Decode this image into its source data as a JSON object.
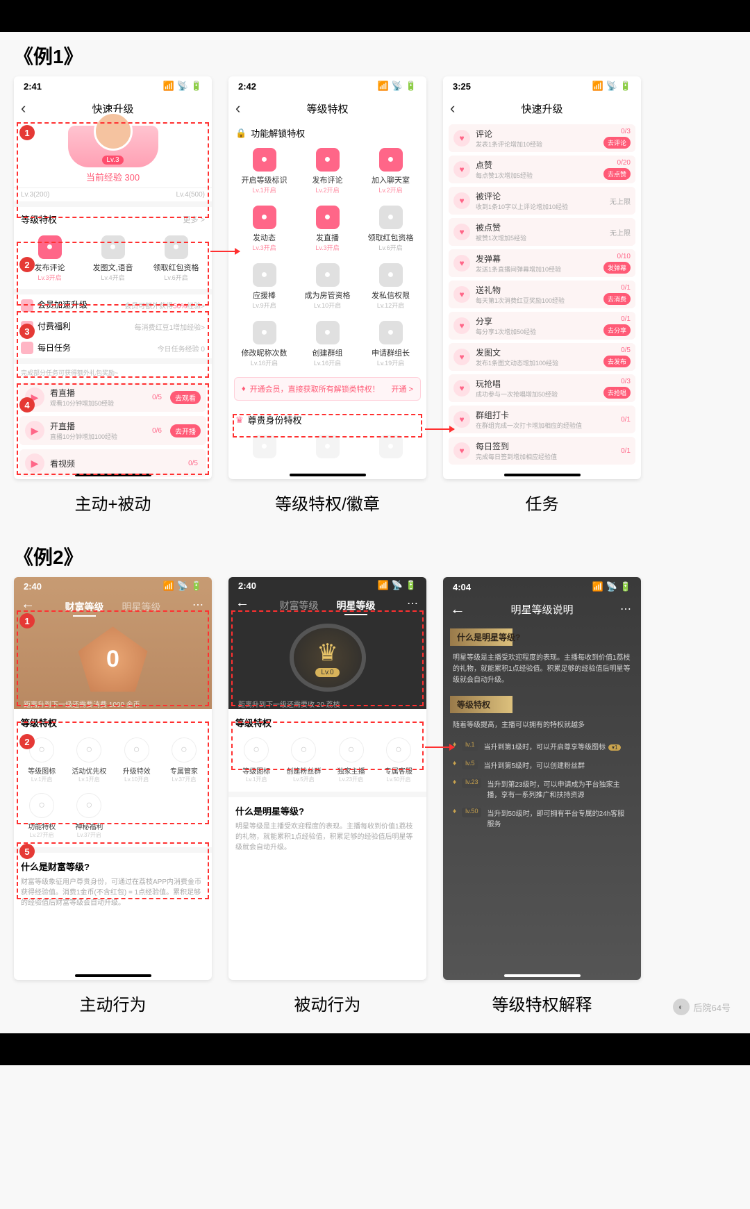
{
  "example1": {
    "label": "《例1》",
    "captions": [
      "主动+被动",
      "等级特权/徽章",
      "任务"
    ],
    "screenA": {
      "time": "2:41",
      "title": "快速升级",
      "hero": {
        "lv_tag": "Lv.3",
        "cur_exp": "当前经验 300",
        "scale_lo": "Lv.3(200)",
        "scale_hi": "Lv.4(500)"
      },
      "priv_header": "等级特权",
      "priv_more": "更多 >",
      "privs": [
        {
          "t": "发布评论",
          "s": "Lv.3开启"
        },
        {
          "t": "发图文,语音",
          "s": "Lv.4开启"
        },
        {
          "t": "领取红包资格",
          "s": "Lv.6开启"
        }
      ],
      "member_hd": "会员加速升级",
      "member_r": "会员可额外获得50%经验>",
      "pay_hd": "付费福利",
      "pay_r": "每消费红豆1增加经验>",
      "daily_hd": "每日任务",
      "daily_r": "今日任务经验 0",
      "bonus_tip": "完成部分任务可获得额外礼包奖励~",
      "tasks": [
        {
          "t": "看直播",
          "s": "观看10分钟增加50经验",
          "cnt": "0/5",
          "btn": "去观看"
        },
        {
          "t": "开直播",
          "s": "直播10分钟增加100经验",
          "cnt": "0/6",
          "btn": "去开播"
        },
        {
          "t": "看视频",
          "s": "",
          "cnt": "0/5",
          "btn": ""
        }
      ]
    },
    "screenB": {
      "time": "2:42",
      "title": "等级特权",
      "sec1": "功能解锁特权",
      "items": [
        {
          "t": "开启等级标识",
          "s": "Lv.1开启",
          "c": "pink"
        },
        {
          "t": "发布评论",
          "s": "Lv.2开启",
          "c": "pink"
        },
        {
          "t": "加入聊天室",
          "s": "Lv.2开启",
          "c": "pink"
        },
        {
          "t": "发动态",
          "s": "Lv.3开启",
          "c": "pink"
        },
        {
          "t": "发直播",
          "s": "Lv.3开启",
          "c": "pink"
        },
        {
          "t": "领取红包资格",
          "s": "Lv.6开启",
          "c": "gray"
        },
        {
          "t": "应援棒",
          "s": "Lv.9开启",
          "c": "gray"
        },
        {
          "t": "成为房管资格",
          "s": "Lv.10开启",
          "c": "gray"
        },
        {
          "t": "发私信权限",
          "s": "Lv.12开启",
          "c": "gray"
        },
        {
          "t": "修改昵称次数",
          "s": "Lv.16开启",
          "c": "gray"
        },
        {
          "t": "创建群组",
          "s": "Lv.16开启",
          "c": "gray"
        },
        {
          "t": "申请群组长",
          "s": "Lv.19开启",
          "c": "gray"
        }
      ],
      "vip_text": "开通会员，直接获取所有解锁类特权！",
      "vip_go": "开通 >",
      "sec2": "尊贵身份特权"
    },
    "screenC": {
      "time": "3:25",
      "title": "快速升级",
      "tasks": [
        {
          "t": "评论",
          "s": "发表1条评论增加10经验",
          "cnt": "0/3",
          "btn": "去评论"
        },
        {
          "t": "点赞",
          "s": "每点赞1次增加5经验",
          "cnt": "0/20",
          "btn": "去点赞"
        },
        {
          "t": "被评论",
          "s": "收到1条10字以上评论增加10经验",
          "cnt": "无上限",
          "btn": ""
        },
        {
          "t": "被点赞",
          "s": "被赞1次增加5经验",
          "cnt": "无上限",
          "btn": ""
        },
        {
          "t": "发弹幕",
          "s": "发送1条直播间弹幕增加10经验",
          "cnt": "0/10",
          "btn": "发弹幕"
        },
        {
          "t": "送礼物",
          "s": "每天第1次消费红豆奖励100经验",
          "cnt": "0/1",
          "btn": "去消费"
        },
        {
          "t": "分享",
          "s": "每分享1次增加50经验",
          "cnt": "0/1",
          "btn": "去分享"
        },
        {
          "t": "发图文",
          "s": "发布1条图文动态增加100经验",
          "cnt": "0/5",
          "btn": "去发布"
        },
        {
          "t": "玩抢唱",
          "s": "成功参与一次抢唱增加50经验",
          "cnt": "0/3",
          "btn": "去抢唱"
        },
        {
          "t": "群组打卡",
          "s": "在群组完成一次打卡增加相应的经验值",
          "cnt": "0/1",
          "btn": ""
        },
        {
          "t": "每日签到",
          "s": "完成每日签到增加相应经验值",
          "cnt": "0/1",
          "btn": ""
        }
      ]
    }
  },
  "example2": {
    "label": "《例2》",
    "captions": [
      "主动行为",
      "被动行为",
      "等级特权解释"
    ],
    "screenA": {
      "time": "2:40",
      "tab_l": "财富等级",
      "tab_r": "明星等级",
      "medal_num": "0",
      "progress_text": "距离升到下一级还需要消费 1000 金币",
      "sec_hd": "等级特权",
      "items": [
        {
          "t": "等级图标",
          "s": "Lv.1开启"
        },
        {
          "t": "活动优先权",
          "s": "Lv.1开启"
        },
        {
          "t": "升级特效",
          "s": "Lv.10开启"
        },
        {
          "t": "专属管家",
          "s": "Lv.37开启"
        },
        {
          "t": "功能特权",
          "s": "Lv.27开启"
        },
        {
          "t": "神秘福利",
          "s": "Lv.37开启"
        }
      ],
      "what_t": "什么是财富等级?",
      "what_p": "财富等级象征用户尊贵身份，可通过在荔枝APP内消费金币获得经验值。消费1金币(不含红包) = 1点经验值。累积足够的经验值后财富等级会自动升级。"
    },
    "screenB": {
      "time": "2:40",
      "tab_l": "财富等级",
      "tab_r": "明星等级",
      "crown_lv": "Lv.0",
      "progress_text": "距离升到下一级还需要收 20 荔枝",
      "sec_hd": "等级特权",
      "items": [
        {
          "t": "等级图标",
          "s": "Lv.1开启"
        },
        {
          "t": "创建粉丝群",
          "s": "Lv.5开启"
        },
        {
          "t": "独家主播",
          "s": "Lv.23开启"
        },
        {
          "t": "专属客服",
          "s": "Lv.50开启"
        }
      ],
      "what_t": "什么是明星等级?",
      "what_p": "明星等级是主播受欢迎程度的表现。主播每收到价值1荔枝的礼物，就能累积1点经验值，积累足够的经验值后明星等级就会自动升级。"
    },
    "screenC": {
      "time": "4:04",
      "title": "明星等级说明",
      "sec1": "什么是明星等级?",
      "sec1_p": "明星等级是主播受欢迎程度的表现。主播每收到价值1荔枝的礼物，就能累积1点经验值。积累足够的经验值后明星等级就会自动升级。",
      "sec2": "等级特权",
      "sec2_sub": "随着等级提高，主播可以拥有的特权就越多",
      "rows": [
        {
          "lv": "lv.1",
          "t": "当升到第1级时，可以开启尊享等级图标",
          "pill": "▾1"
        },
        {
          "lv": "lv.5",
          "t": "当升到第5级时，可以创建粉丝群"
        },
        {
          "lv": "lv.23",
          "t": "当升到第23级时，可以申请成为平台独家主播，享有一系列推广和扶持资源"
        },
        {
          "lv": "lv.50",
          "t": "当升到50级时，即可拥有平台专属的24h客服服务"
        }
      ]
    }
  },
  "watermark": "后院64号"
}
